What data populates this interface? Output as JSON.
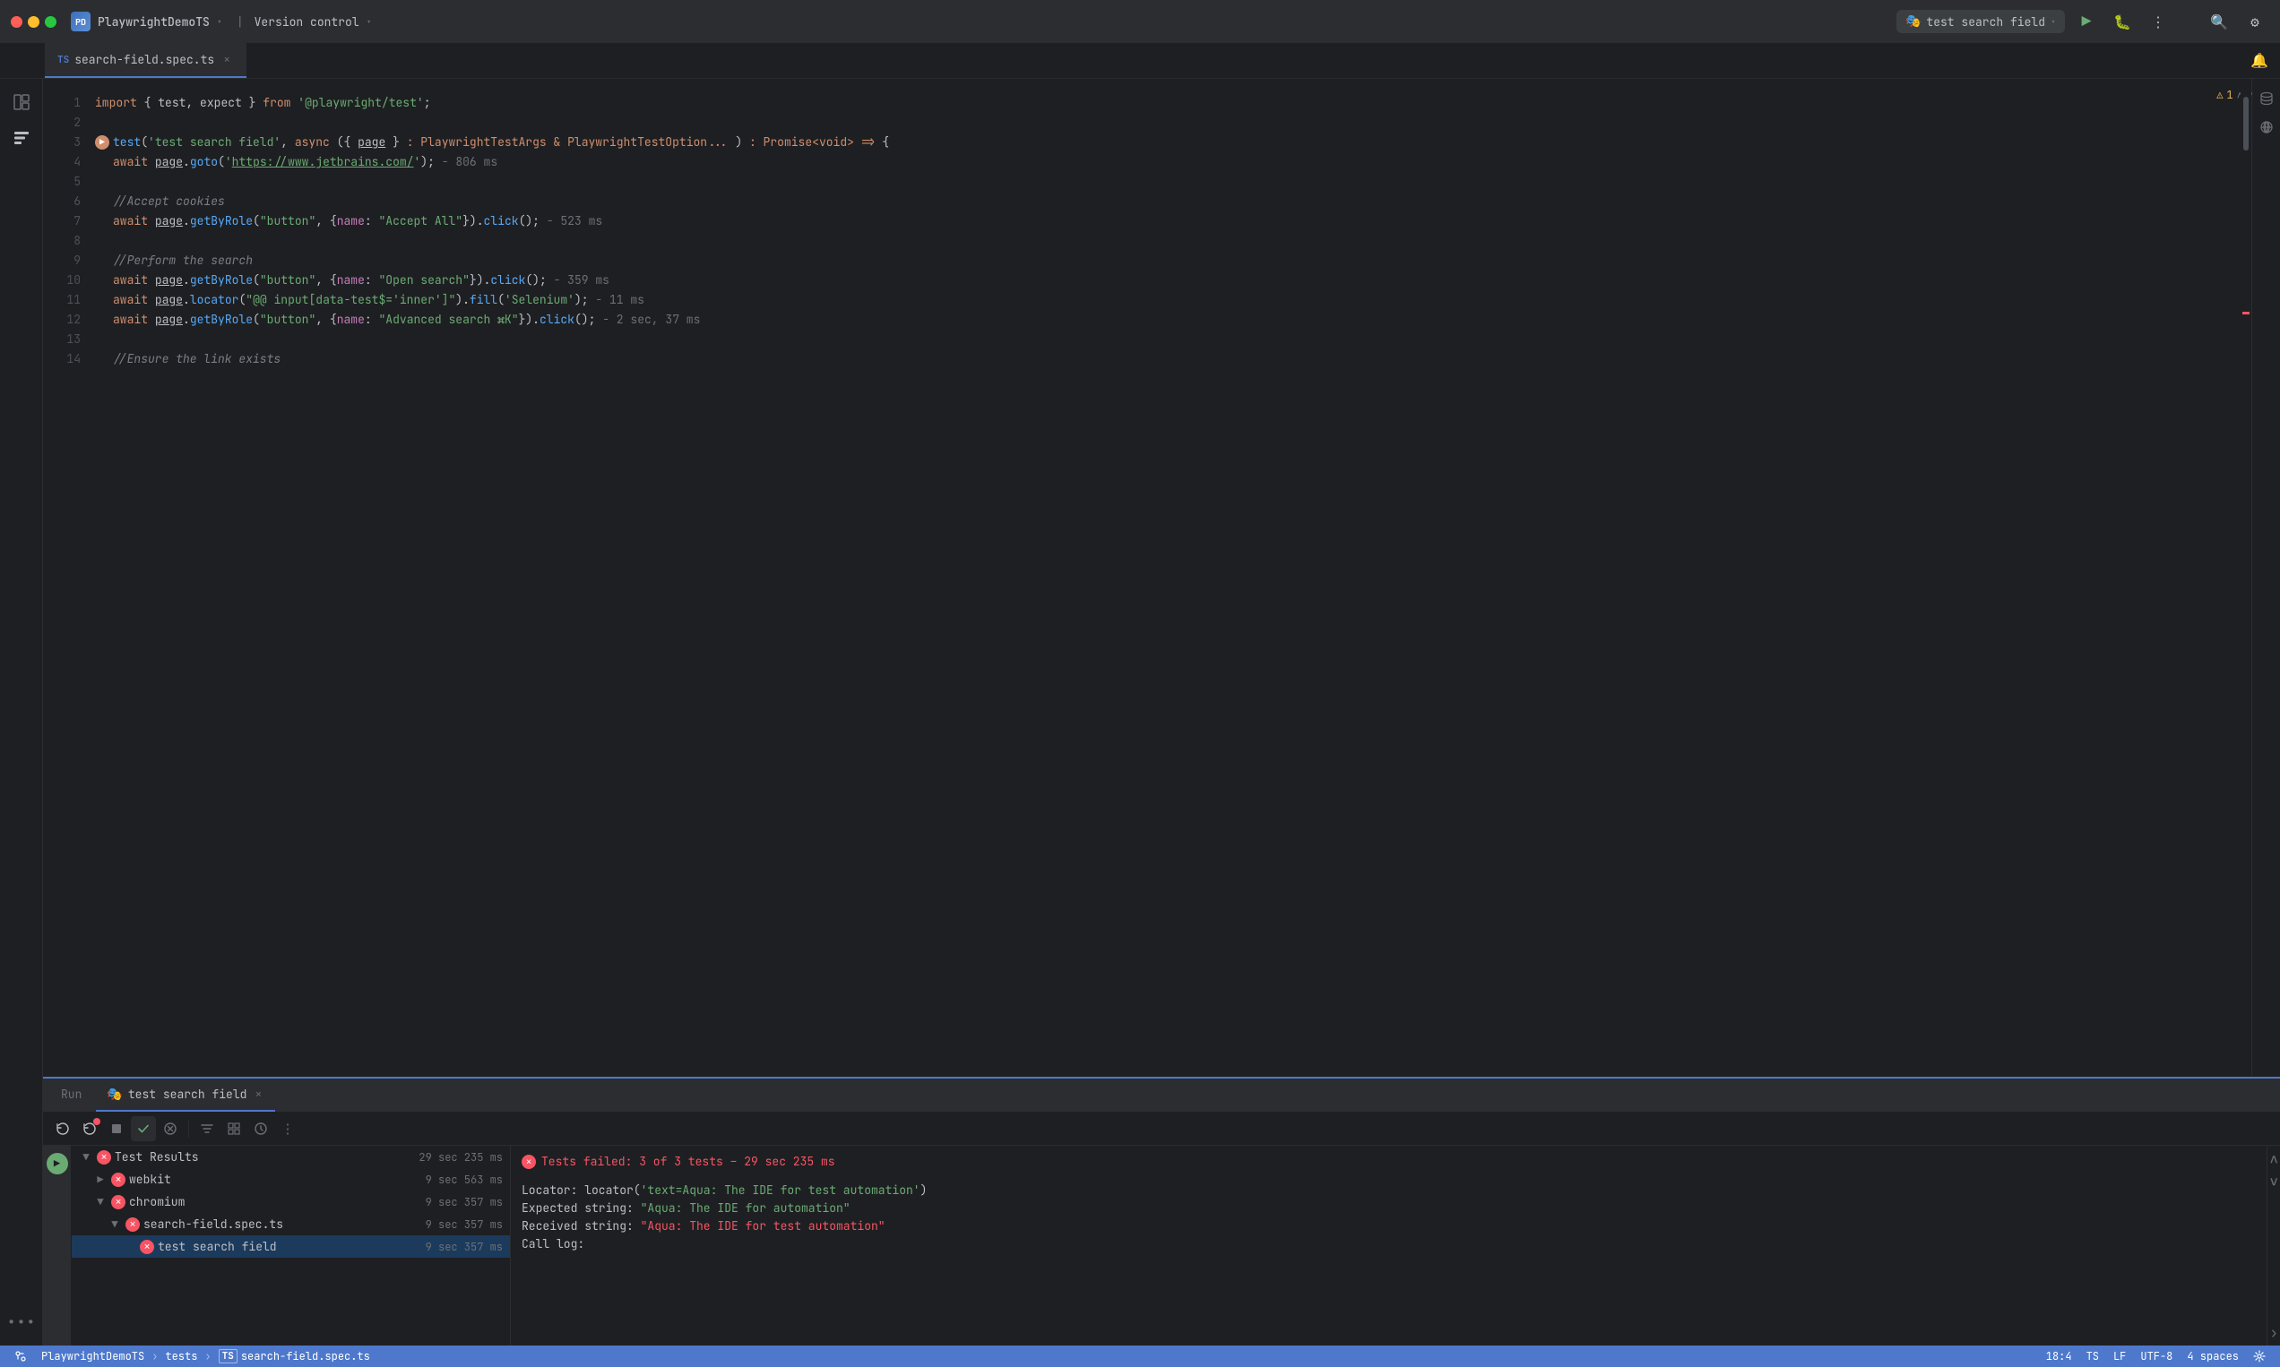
{
  "titleBar": {
    "appIcon": "PD",
    "appName": "PlaywrightDemoTS",
    "versionControl": "Version control",
    "runConfig": {
      "name": "test search field",
      "icon": "🎭"
    },
    "windowControls": {
      "close": "close",
      "minimize": "minimize",
      "maximize": "maximize"
    }
  },
  "tabs": [
    {
      "name": "search-field.spec.ts",
      "icon": "TS",
      "active": true,
      "closable": true
    }
  ],
  "editor": {
    "lines": [
      {
        "num": 1,
        "content": "import { test, expect } from '@playwright/test';",
        "type": "import"
      },
      {
        "num": 2,
        "content": "",
        "type": "empty"
      },
      {
        "num": 3,
        "content": "test('test search field', async ({ page } : PlaywrightTestArgs & PlaywrightTestOption... ) : Promise<void> => {",
        "type": "test",
        "hasBreakpoint": true
      },
      {
        "num": 4,
        "content": "    await page.goto('https://www.jetbrains.com/'); - 806 ms",
        "type": "code"
      },
      {
        "num": 5,
        "content": "",
        "type": "empty"
      },
      {
        "num": 6,
        "content": "    //Accept cookies",
        "type": "comment"
      },
      {
        "num": 7,
        "content": "    await page.getByRole(\"button\", {name: \"Accept All\"}).click(); - 523 ms",
        "type": "code"
      },
      {
        "num": 8,
        "content": "",
        "type": "empty"
      },
      {
        "num": 9,
        "content": "    //Perform the search",
        "type": "comment"
      },
      {
        "num": 10,
        "content": "    await page.getByRole(\"button\", {name: \"Open search\"}).click(); - 359 ms",
        "type": "code"
      },
      {
        "num": 11,
        "content": "    await page.locator(\"@@ input[data-test$='inner']\").fill('Selenium'); - 11 ms",
        "type": "code"
      },
      {
        "num": 12,
        "content": "    await page.getByRole(\"button\", {name: \"Advanced search ⌘K\"}).click(); - 2 sec, 37 ms",
        "type": "code"
      },
      {
        "num": 13,
        "content": "",
        "type": "empty"
      },
      {
        "num": 14,
        "content": "    //Ensure the link exists",
        "type": "comment"
      }
    ],
    "warning": {
      "count": 1,
      "icon": "⚠"
    }
  },
  "bottomPanel": {
    "tabs": [
      {
        "name": "Run",
        "active": false
      },
      {
        "name": "test search field",
        "active": true,
        "closable": true,
        "icon": "🎭"
      }
    ],
    "toolbar": {
      "buttons": [
        "restart",
        "restart-debug",
        "stop",
        "done",
        "cancel",
        "filter",
        "expand",
        "more"
      ]
    },
    "testResults": {
      "summary": "29 sec 235 ms",
      "status": "Tests failed: 3 of 3 tests – 29 sec 235 ms",
      "items": [
        {
          "name": "Test Results",
          "time": "29 sec 235 ms",
          "status": "fail",
          "indent": 0,
          "expanded": true
        },
        {
          "name": "webkit",
          "time": "9 sec 563 ms",
          "status": "fail",
          "indent": 1,
          "expanded": false
        },
        {
          "name": "chromium",
          "time": "9 sec 357 ms",
          "status": "fail",
          "indent": 1,
          "expanded": true
        },
        {
          "name": "search-field.spec.ts",
          "time": "9 sec 357 ms",
          "status": "fail",
          "indent": 2,
          "expanded": true
        },
        {
          "name": "test search field",
          "time": "9 sec 357 ms",
          "status": "fail",
          "indent": 3,
          "selected": true
        }
      ]
    },
    "logOutput": {
      "failHeader": "Tests failed: 3 of 3 tests – 29 sec 235 ms",
      "lines": [
        "Locator: locator('text=Aqua: The IDE for test automation')",
        "Expected string: \"Aqua: The IDE for automation\"",
        "Received string: \"Aqua: The IDE for test automation\"",
        "Call log:"
      ]
    }
  },
  "statusBar": {
    "project": "PlaywrightDemoTS",
    "breadcrumb1": "tests",
    "breadcrumb2": "search-field.spec.ts",
    "position": "18:4",
    "fileType": "TS",
    "lineEnding": "LF",
    "encoding": "UTF-8",
    "indentation": "4 spaces"
  },
  "activityBar": {
    "items": [
      "folder",
      "extensions",
      "more"
    ]
  }
}
